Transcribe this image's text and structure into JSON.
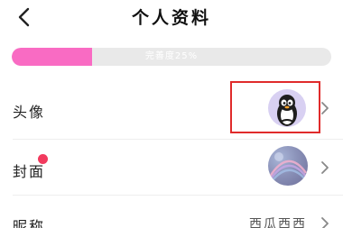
{
  "header": {
    "title": "个人资料"
  },
  "profile_completion": {
    "label": "完善度25%",
    "percent": 25,
    "fill_color": "#f96bc3"
  },
  "rows": [
    {
      "label": "头像"
    },
    {
      "label": "封面",
      "has_badge": true
    },
    {
      "label": "昵称",
      "value": "西瓜西西"
    }
  ],
  "colors": {
    "accent_pink": "#f96bc3",
    "badge_red": "#f23a5e",
    "highlight_box": "#e02b2b",
    "avatar_bg": "#d8d0f2"
  },
  "icons": {
    "back": "chevron-left-icon",
    "row_arrow": "chevron-right-icon",
    "avatar": "penguin-avatar-icon"
  }
}
